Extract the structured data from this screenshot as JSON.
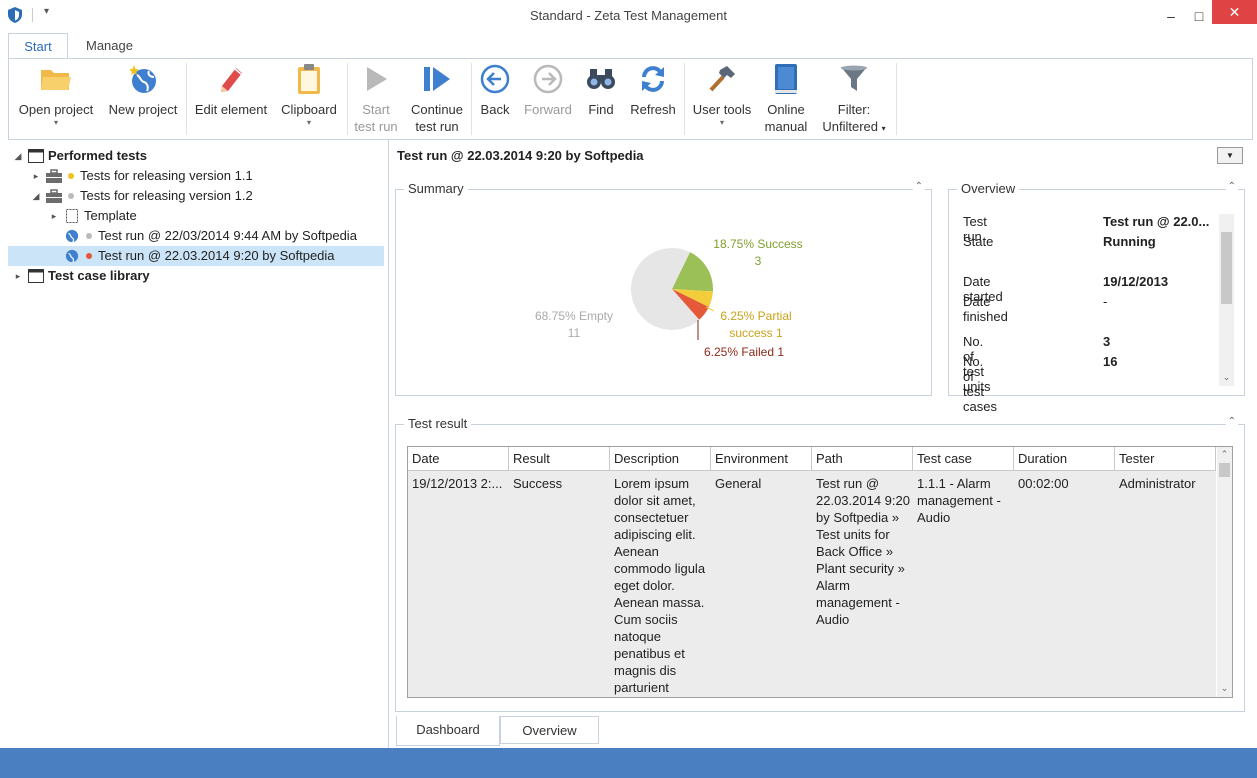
{
  "window": {
    "title": "Standard - Zeta Test Management",
    "min_glyph": "–",
    "max_glyph": "□",
    "close_glyph": "✕",
    "qat_glyph": "▾"
  },
  "ribbon_tabs": [
    {
      "label": "Start",
      "active": true
    },
    {
      "label": "Manage",
      "active": false
    }
  ],
  "ribbon": {
    "open_project": "Open project",
    "new_project": "New project",
    "edit_element": "Edit element",
    "clipboard": "Clipboard",
    "start_test_run_1": "Start",
    "start_test_run_2": "test run",
    "continue_test_run_1": "Continue",
    "continue_test_run_2": "test run",
    "back": "Back",
    "forward": "Forward",
    "find": "Find",
    "refresh": "Refresh",
    "user_tools": "User tools",
    "online_manual_1": "Online",
    "online_manual_2": "manual",
    "filter_1": "Filter:",
    "filter_2": "Unfiltered",
    "caret": "▾"
  },
  "tree": {
    "performed_tests": "Performed tests",
    "release_11": "Tests for releasing version 1.1",
    "release_12": "Tests for releasing version 1.2",
    "template": "Template",
    "run_1": "Test run @ 22/03/2014 9:44 AM by Softpedia",
    "run_2": "Test run @ 22.03.2014 9:20 by Softpedia",
    "test_case_library": "Test case library"
  },
  "header": {
    "run_title": "Test run @ 22.03.2014 9:20 by Softpedia"
  },
  "summary": {
    "title": "Summary",
    "success_label": "18.75% Success",
    "success_count": "3",
    "partial_label": "6.25% Partial",
    "partial_label2": "success 1",
    "failed_label": "6.25% Failed 1",
    "empty_label": "68.75% Empty",
    "empty_count": "11"
  },
  "chart_data": {
    "type": "pie",
    "slices": [
      {
        "name": "Success",
        "percent": 18.75,
        "count": 3,
        "color": "#9bc057"
      },
      {
        "name": "Partial success",
        "percent": 6.25,
        "count": 1,
        "color": "#f3ce3a"
      },
      {
        "name": "Failed",
        "percent": 6.25,
        "count": 1,
        "color": "#e4593a"
      },
      {
        "name": "Empty",
        "percent": 68.75,
        "count": 11,
        "color": "#e6e6e6"
      }
    ]
  },
  "overview": {
    "title": "Overview",
    "rows": [
      {
        "key": "Test run",
        "value": "Test run @ 22.0..."
      },
      {
        "key": "State",
        "value": "Running"
      },
      {
        "key": "Date started",
        "value": "19/12/2013"
      },
      {
        "key": "Date finished",
        "value": "-"
      },
      {
        "key": "No. of test units",
        "value": "3"
      },
      {
        "key": "No. of test cases",
        "value": "16"
      }
    ]
  },
  "test_result": {
    "title": "Test result",
    "columns": [
      "Date",
      "Result",
      "Description",
      "Environment",
      "Path",
      "Test case",
      "Duration",
      "Tester"
    ],
    "row": {
      "date": "19/12/2013 2:...",
      "result": "Success",
      "description": [
        "Lorem ipsum",
        "dolor sit amet,",
        "consectetuer",
        "adipiscing elit.",
        "Aenean",
        "commodo ligula",
        "eget dolor.",
        "Aenean massa.",
        "Cum sociis",
        "natoque",
        "penatibus et",
        "magnis dis",
        "parturient"
      ],
      "environment": "General",
      "path": [
        "Test run @",
        "22.03.2014 9:20",
        "by Softpedia »",
        "Test units for",
        "Back Office »",
        "Plant security »",
        "Alarm",
        "management -",
        "Audio"
      ],
      "test_case": [
        "1.1.1 - Alarm",
        "management -",
        "Audio"
      ],
      "duration": "00:02:00",
      "tester": "Administrator"
    }
  },
  "bottom_tabs": [
    {
      "label": "Dashboard",
      "active": true
    },
    {
      "label": "Overview",
      "active": false
    }
  ],
  "colors": {
    "accent": "#2b6cb8",
    "statusbar": "#4a7fc1",
    "selection": "#cce4f7",
    "close": "#e04343"
  }
}
